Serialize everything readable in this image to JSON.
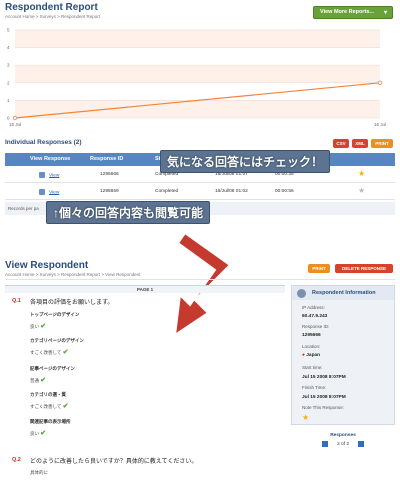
{
  "report": {
    "title": "Respondent Report",
    "breadcrumb": "Account Home > Surveys > Respondent Report",
    "view_more": "View More Reports..."
  },
  "chart_data": {
    "type": "line",
    "x": [
      "15 Jul",
      "16 Jul"
    ],
    "series": [
      {
        "values": [
          0,
          2
        ]
      }
    ],
    "ylim": [
      0,
      5
    ],
    "yticks": [
      "0",
      "1",
      "2",
      "3",
      "4",
      "5"
    ],
    "grid": true,
    "color": "#f0843a"
  },
  "individual": {
    "title": "Individual Responses (2)",
    "buttons": {
      "csv": "CSV",
      "xml": "XML",
      "print": "PRINT"
    },
    "headers": {
      "view": "View Response",
      "id": "Response ID",
      "status": "St"
    },
    "rows": [
      {
        "view": "View",
        "id": "1295666",
        "status": "Completed",
        "date": "16/Jul/08 01:07",
        "duration": "00:00:35"
      },
      {
        "view": "View",
        "id": "1295659",
        "status": "Completed",
        "date": "16/Jul/08 01:02",
        "duration": "00:00:56"
      }
    ],
    "pager": "Records per pa"
  },
  "callouts": {
    "top": "気になる回答にはチェック！",
    "bottom": "↑個々の回答内容も閲覧可能"
  },
  "view_respondent": {
    "title": "View Respondent",
    "breadcrumb": "Account Home > Surveys > Respondent Report > View Respondent",
    "print": "PRINT",
    "delete": "DELETE RESPONSE",
    "page": "PAGE 1",
    "q1": {
      "num": "Q.1",
      "text": "各項目の評価をお願いします。",
      "items": [
        {
          "label": "トップページのデザイン",
          "answer": "良い"
        },
        {
          "label": "カテゴリページのデザイン",
          "answer": "すごく改善して"
        },
        {
          "label": "記事ページのデザイン",
          "answer": "普通"
        },
        {
          "label": "カテゴリの選・質",
          "answer": "すごく改善して"
        },
        {
          "label": "関連記事の表示場所",
          "answer": "良い"
        }
      ]
    },
    "q2": {
      "num": "Q.2",
      "text": "どのように改善したら良いですか？具体的に教えてください。",
      "answer": "具体的に"
    }
  },
  "side": {
    "title": "Respondent Information",
    "ip_label": "IP Address:",
    "ip": "60.47.9.243",
    "rid_label": "Response ID:",
    "rid": "1295666",
    "loc_label": "Location:",
    "loc": "Japan",
    "start_label": "Start time:",
    "start": "Jul 15 2008 8:07PM",
    "finish_label": "Finish Time:",
    "finish": "Jul 15 2008 8:07PM",
    "note_label": "Note This Response:"
  },
  "responses": {
    "label": "Responses",
    "count": "2 of 2"
  }
}
